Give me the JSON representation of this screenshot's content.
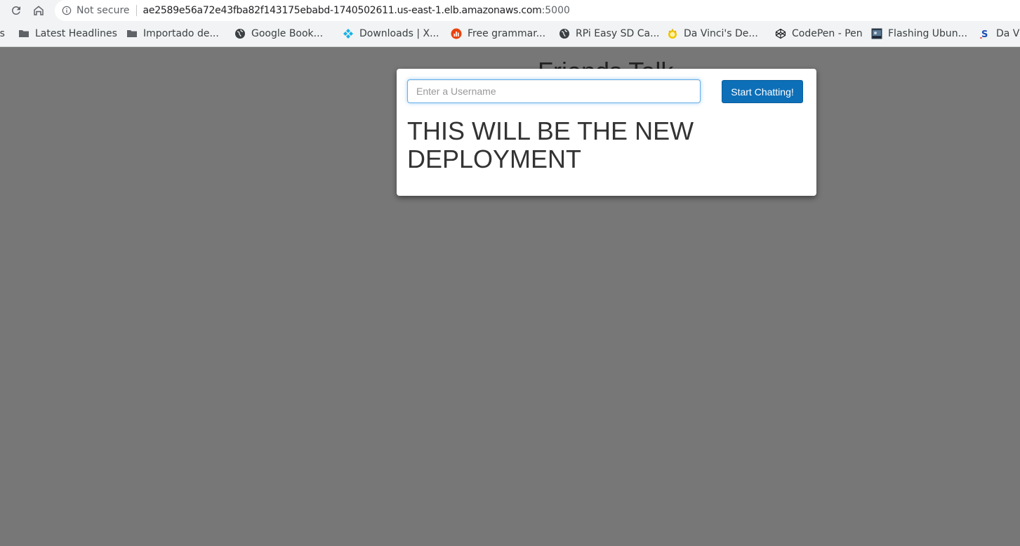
{
  "browser": {
    "security_label": "Not secure",
    "url_host": "ae2589e56a72e43fba82f143175ebabd-1740502611.us-east-1.elb.amazonaws.com",
    "url_port": ":5000",
    "bookmarks": [
      {
        "label": "os",
        "icon": "apps-icon"
      },
      {
        "label": "Latest Headlines",
        "icon": "folder-icon"
      },
      {
        "label": "Importado de...",
        "icon": "folder-icon"
      },
      {
        "label": "Google Book...",
        "icon": "globe-icon"
      },
      {
        "label": "Downloads | X...",
        "icon": "kodi-icon"
      },
      {
        "label": "Free grammar...",
        "icon": "chart-icon"
      },
      {
        "label": "RPi Easy SD Ca...",
        "icon": "globe-icon"
      },
      {
        "label": "Da Vinci's De...",
        "icon": "davinci-icon"
      },
      {
        "label": "CodePen - Pen",
        "icon": "codepen-icon"
      },
      {
        "label": "Flashing Ubun...",
        "icon": "ubuntu-image-icon"
      },
      {
        "label": "Da Vi",
        "icon": "s-icon"
      }
    ]
  },
  "page": {
    "title_behind": "Friends Talk",
    "modal": {
      "username_placeholder": "Enter a Username",
      "start_button": "Start Chatting!",
      "heading": "THIS WILL BE THE NEW DEPLOYMENT"
    }
  },
  "colors": {
    "overlay_bg": "#777777",
    "button_bg": "#0d6fb8",
    "input_focus": "#66afe9"
  }
}
